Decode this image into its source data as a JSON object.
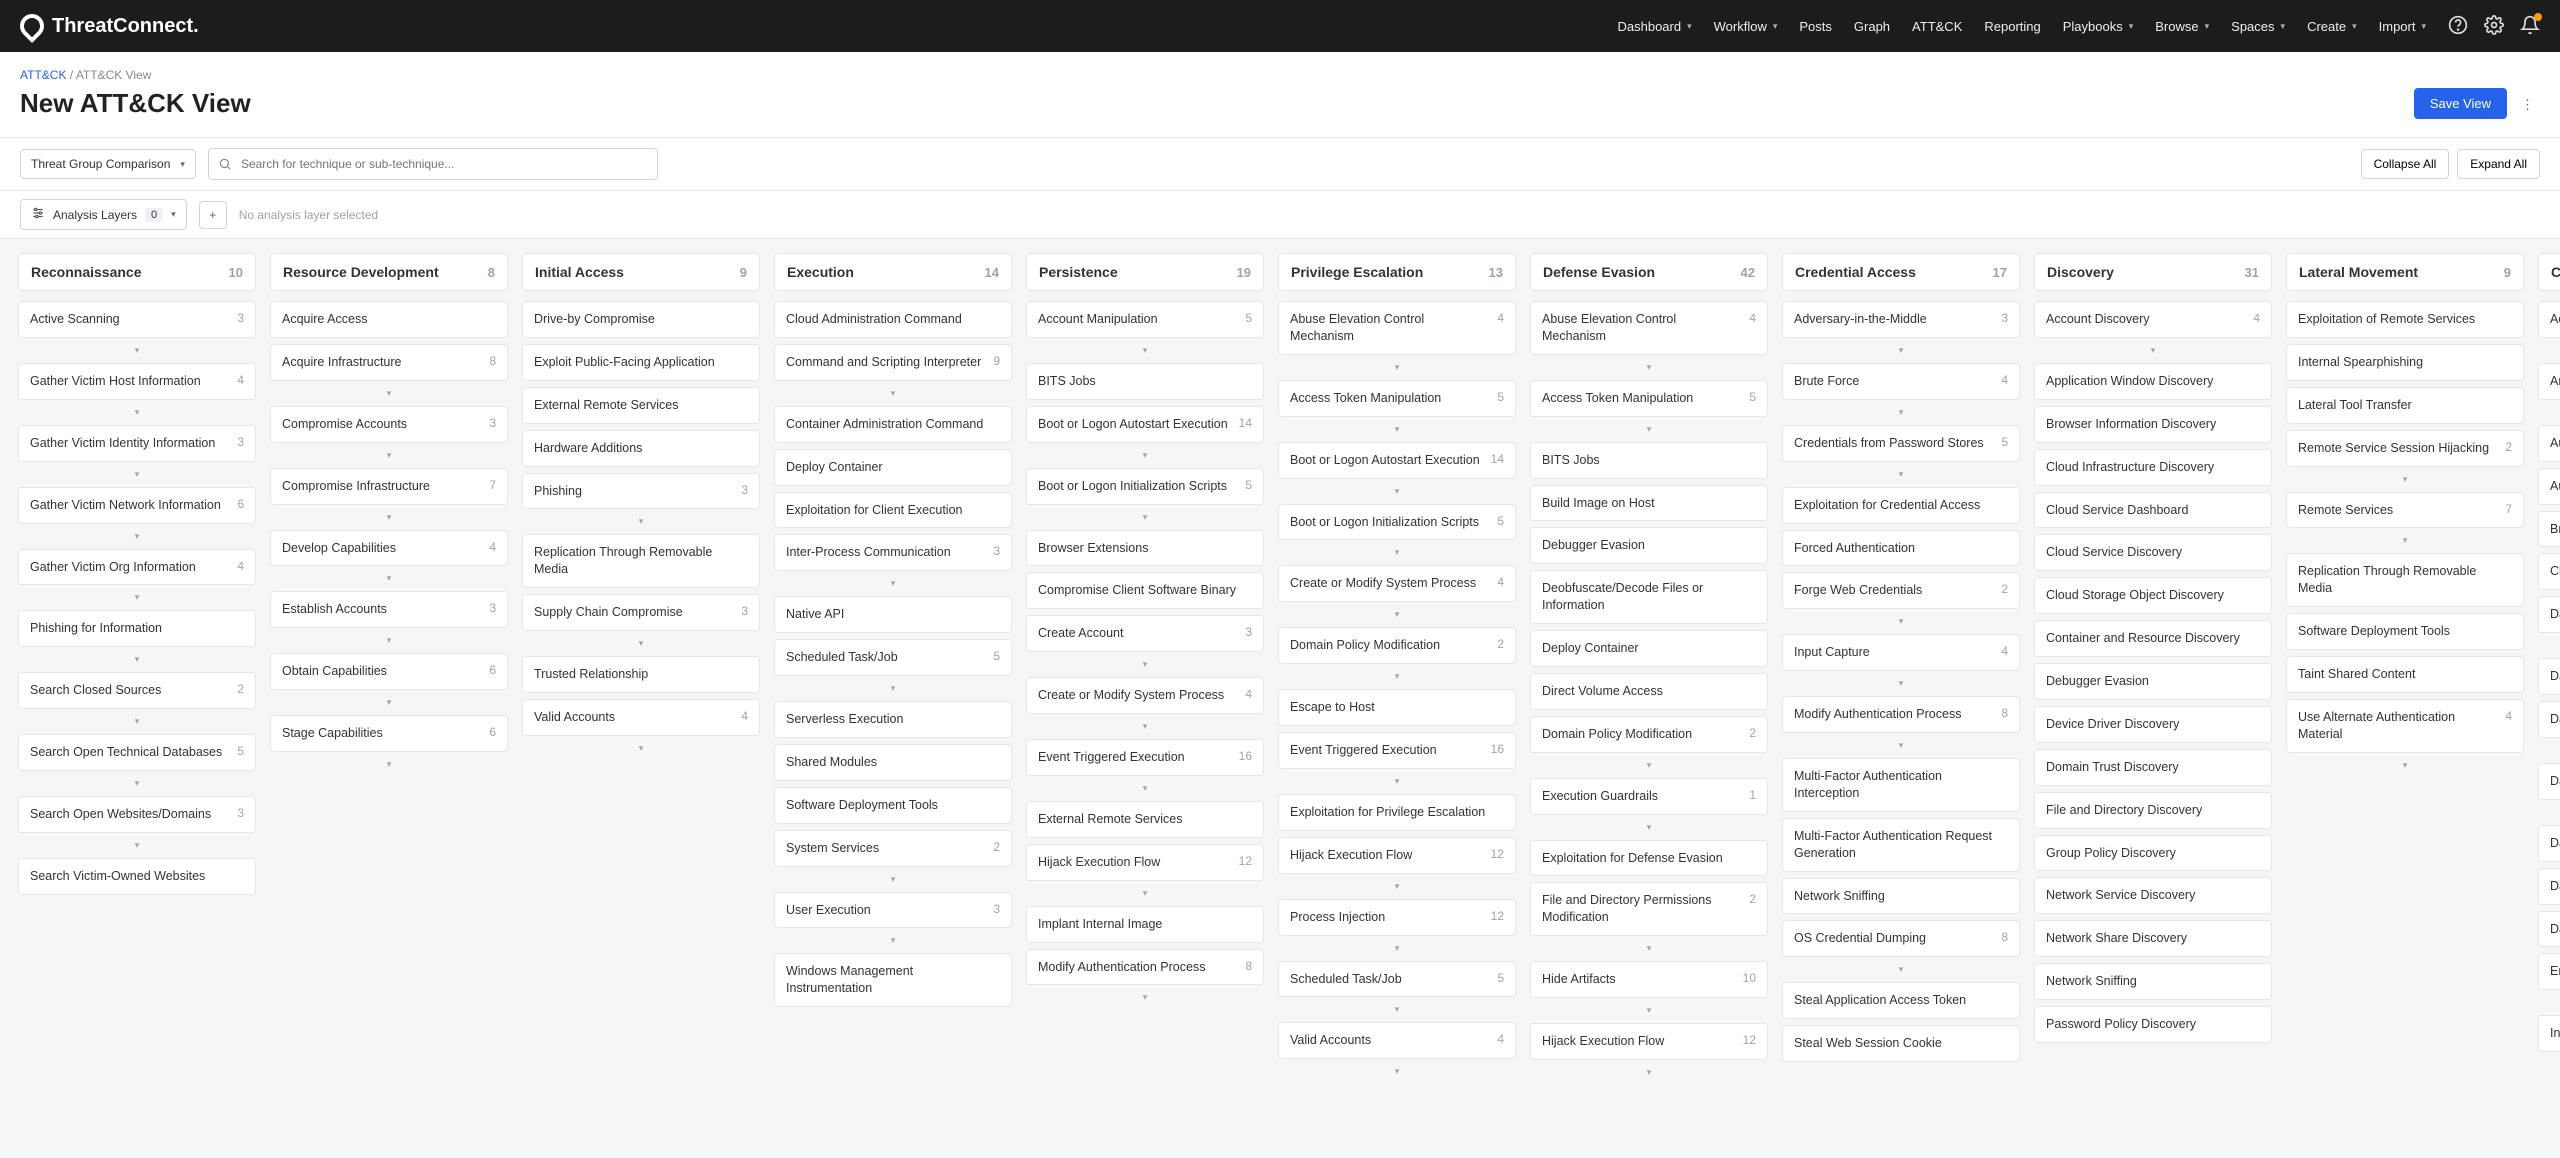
{
  "brand": "ThreatConnect.",
  "nav": [
    "Dashboard",
    "Workflow",
    "Posts",
    "Graph",
    "ATT&CK",
    "Reporting",
    "Playbooks",
    "Browse",
    "Spaces",
    "Create",
    "Import"
  ],
  "nav_chev": [
    true,
    true,
    false,
    false,
    false,
    false,
    true,
    true,
    true,
    true,
    true
  ],
  "crumb_link": "ATT&CK",
  "crumb_current": "ATT&CK View",
  "page_title": "New ATT&CK View",
  "save_btn": "Save View",
  "mode_select": "Threat Group Comparison",
  "search_placeholder": "Search for technique or sub-technique...",
  "collapse_btn": "Collapse All",
  "expand_btn": "Expand All",
  "layers_label": "Analysis Layers",
  "layers_count": "0",
  "layers_hint": "No analysis layer selected",
  "columns": [
    {
      "title": "Reconnaissance",
      "count": 10,
      "items": [
        {
          "t": "Active Scanning",
          "c": 3,
          "e": true
        },
        {
          "t": "Gather Victim Host Information",
          "c": 4,
          "e": true
        },
        {
          "t": "Gather Victim Identity Information",
          "c": 3,
          "e": true
        },
        {
          "t": "Gather Victim Network Information",
          "c": 6,
          "e": true
        },
        {
          "t": "Gather Victim Org Information",
          "c": 4,
          "e": true
        },
        {
          "t": "Phishing for Information",
          "e": true
        },
        {
          "t": "Search Closed Sources",
          "c": 2,
          "e": true
        },
        {
          "t": "Search Open Technical Databases",
          "c": 5,
          "e": true
        },
        {
          "t": "Search Open Websites/Domains",
          "c": 3,
          "e": true
        },
        {
          "t": "Search Victim-Owned Websites"
        }
      ]
    },
    {
      "title": "Resource Development",
      "count": 8,
      "items": [
        {
          "t": "Acquire Access"
        },
        {
          "t": "Acquire Infrastructure",
          "c": 8,
          "e": true
        },
        {
          "t": "Compromise Accounts",
          "c": 3,
          "e": true
        },
        {
          "t": "Compromise Infrastructure",
          "c": 7,
          "e": true
        },
        {
          "t": "Develop Capabilities",
          "c": 4,
          "e": true
        },
        {
          "t": "Establish Accounts",
          "c": 3,
          "e": true
        },
        {
          "t": "Obtain Capabilities",
          "c": 6,
          "e": true
        },
        {
          "t": "Stage Capabilities",
          "c": 6,
          "e": true
        }
      ]
    },
    {
      "title": "Initial Access",
      "count": 9,
      "items": [
        {
          "t": "Drive-by Compromise"
        },
        {
          "t": "Exploit Public-Facing Application"
        },
        {
          "t": "External Remote Services"
        },
        {
          "t": "Hardware Additions"
        },
        {
          "t": "Phishing",
          "c": 3,
          "e": true
        },
        {
          "t": "Replication Through Removable Media"
        },
        {
          "t": "Supply Chain Compromise",
          "c": 3,
          "e": true
        },
        {
          "t": "Trusted Relationship"
        },
        {
          "t": "Valid Accounts",
          "c": 4,
          "e": true
        }
      ]
    },
    {
      "title": "Execution",
      "count": 14,
      "items": [
        {
          "t": "Cloud Administration Command"
        },
        {
          "t": "Command and Scripting Interpreter",
          "c": 9,
          "e": true
        },
        {
          "t": "Container Administration Command"
        },
        {
          "t": "Deploy Container"
        },
        {
          "t": "Exploitation for Client Execution"
        },
        {
          "t": "Inter-Process Communication",
          "c": 3,
          "e": true
        },
        {
          "t": "Native API"
        },
        {
          "t": "Scheduled Task/Job",
          "c": 5,
          "e": true
        },
        {
          "t": "Serverless Execution"
        },
        {
          "t": "Shared Modules"
        },
        {
          "t": "Software Deployment Tools"
        },
        {
          "t": "System Services",
          "c": 2,
          "e": true
        },
        {
          "t": "User Execution",
          "c": 3,
          "e": true
        },
        {
          "t": "Windows Management Instrumentation"
        }
      ]
    },
    {
      "title": "Persistence",
      "count": 19,
      "items": [
        {
          "t": "Account Manipulation",
          "c": 5,
          "e": true
        },
        {
          "t": "BITS Jobs"
        },
        {
          "t": "Boot or Logon Autostart Execution",
          "c": 14,
          "e": true
        },
        {
          "t": "Boot or Logon Initialization Scripts",
          "c": 5,
          "e": true
        },
        {
          "t": "Browser Extensions"
        },
        {
          "t": "Compromise Client Software Binary"
        },
        {
          "t": "Create Account",
          "c": 3,
          "e": true
        },
        {
          "t": "Create or Modify System Process",
          "c": 4,
          "e": true
        },
        {
          "t": "Event Triggered Execution",
          "c": 16,
          "e": true
        },
        {
          "t": "External Remote Services"
        },
        {
          "t": "Hijack Execution Flow",
          "c": 12,
          "e": true
        },
        {
          "t": "Implant Internal Image"
        },
        {
          "t": "Modify Authentication Process",
          "c": 8,
          "e": true
        }
      ]
    },
    {
      "title": "Privilege Escalation",
      "count": 13,
      "items": [
        {
          "t": "Abuse Elevation Control Mechanism",
          "c": 4,
          "e": true
        },
        {
          "t": "Access Token Manipulation",
          "c": 5,
          "e": true
        },
        {
          "t": "Boot or Logon Autostart Execution",
          "c": 14,
          "e": true
        },
        {
          "t": "Boot or Logon Initialization Scripts",
          "c": 5,
          "e": true
        },
        {
          "t": "Create or Modify System Process",
          "c": 4,
          "e": true
        },
        {
          "t": "Domain Policy Modification",
          "c": 2,
          "e": true
        },
        {
          "t": "Escape to Host"
        },
        {
          "t": "Event Triggered Execution",
          "c": 16,
          "e": true
        },
        {
          "t": "Exploitation for Privilege Escalation"
        },
        {
          "t": "Hijack Execution Flow",
          "c": 12,
          "e": true
        },
        {
          "t": "Process Injection",
          "c": 12,
          "e": true
        },
        {
          "t": "Scheduled Task/Job",
          "c": 5,
          "e": true
        },
        {
          "t": "Valid Accounts",
          "c": 4,
          "e": true
        }
      ]
    },
    {
      "title": "Defense Evasion",
      "count": 42,
      "items": [
        {
          "t": "Abuse Elevation Control Mechanism",
          "c": 4,
          "e": true
        },
        {
          "t": "Access Token Manipulation",
          "c": 5,
          "e": true
        },
        {
          "t": "BITS Jobs"
        },
        {
          "t": "Build Image on Host"
        },
        {
          "t": "Debugger Evasion"
        },
        {
          "t": "Deobfuscate/Decode Files or Information"
        },
        {
          "t": "Deploy Container"
        },
        {
          "t": "Direct Volume Access"
        },
        {
          "t": "Domain Policy Modification",
          "c": 2,
          "e": true
        },
        {
          "t": "Execution Guardrails",
          "c": 1,
          "e": true
        },
        {
          "t": "Exploitation for Defense Evasion"
        },
        {
          "t": "File and Directory Permissions Modification",
          "c": 2,
          "e": true
        },
        {
          "t": "Hide Artifacts",
          "c": 10,
          "e": true
        },
        {
          "t": "Hijack Execution Flow",
          "c": 12,
          "e": true
        }
      ]
    },
    {
      "title": "Credential Access",
      "count": 17,
      "items": [
        {
          "t": "Adversary-in-the-Middle",
          "c": 3,
          "e": true
        },
        {
          "t": "Brute Force",
          "c": 4,
          "e": true
        },
        {
          "t": "Credentials from Password Stores",
          "c": 5,
          "e": true
        },
        {
          "t": "Exploitation for Credential Access"
        },
        {
          "t": "Forced Authentication"
        },
        {
          "t": "Forge Web Credentials",
          "c": 2,
          "e": true
        },
        {
          "t": "Input Capture",
          "c": 4,
          "e": true
        },
        {
          "t": "Modify Authentication Process",
          "c": 8,
          "e": true
        },
        {
          "t": "Multi-Factor Authentication Interception"
        },
        {
          "t": "Multi-Factor Authentication Request Generation"
        },
        {
          "t": "Network Sniffing"
        },
        {
          "t": "OS Credential Dumping",
          "c": 8,
          "e": true
        },
        {
          "t": "Steal Application Access Token"
        },
        {
          "t": "Steal Web Session Cookie"
        }
      ]
    },
    {
      "title": "Discovery",
      "count": 31,
      "items": [
        {
          "t": "Account Discovery",
          "c": 4,
          "e": true
        },
        {
          "t": "Application Window Discovery"
        },
        {
          "t": "Browser Information Discovery"
        },
        {
          "t": "Cloud Infrastructure Discovery"
        },
        {
          "t": "Cloud Service Dashboard"
        },
        {
          "t": "Cloud Service Discovery"
        },
        {
          "t": "Cloud Storage Object Discovery"
        },
        {
          "t": "Container and Resource Discovery"
        },
        {
          "t": "Debugger Evasion"
        },
        {
          "t": "Device Driver Discovery"
        },
        {
          "t": "Domain Trust Discovery"
        },
        {
          "t": "File and Directory Discovery"
        },
        {
          "t": "Group Policy Discovery"
        },
        {
          "t": "Network Service Discovery"
        },
        {
          "t": "Network Share Discovery"
        },
        {
          "t": "Network Sniffing"
        },
        {
          "t": "Password Policy Discovery"
        }
      ]
    },
    {
      "title": "Lateral Movement",
      "count": 9,
      "items": [
        {
          "t": "Exploitation of Remote Services"
        },
        {
          "t": "Internal Spearphishing"
        },
        {
          "t": "Lateral Tool Transfer"
        },
        {
          "t": "Remote Service Session Hijacking",
          "c": 2,
          "e": true
        },
        {
          "t": "Remote Services",
          "c": 7,
          "e": true
        },
        {
          "t": "Replication Through Removable Media"
        },
        {
          "t": "Software Deployment Tools"
        },
        {
          "t": "Taint Shared Content"
        },
        {
          "t": "Use Alternate Authentication Material",
          "c": 4,
          "e": true
        }
      ]
    },
    {
      "title": "Collection",
      "count": "",
      "items": [
        {
          "t": "Adversary-in-the-Middle",
          "e": true
        },
        {
          "t": "Archive Collected Data",
          "e": true
        },
        {
          "t": "Audio Capture"
        },
        {
          "t": "Automated Collection"
        },
        {
          "t": "Browser Session Hijacking"
        },
        {
          "t": "Clipboard Data"
        },
        {
          "t": "Data Staged",
          "e": true
        },
        {
          "t": "Data from Cloud Storage"
        },
        {
          "t": "Data from Configuration Repository",
          "e": true
        },
        {
          "t": "Data from Information Repositories",
          "e": true
        },
        {
          "t": "Data from Local System"
        },
        {
          "t": "Data from Network Shared"
        },
        {
          "t": "Data from Removable Media"
        },
        {
          "t": "Email Collection",
          "e": true
        },
        {
          "t": "Input Capture",
          "e": true
        }
      ]
    }
  ]
}
